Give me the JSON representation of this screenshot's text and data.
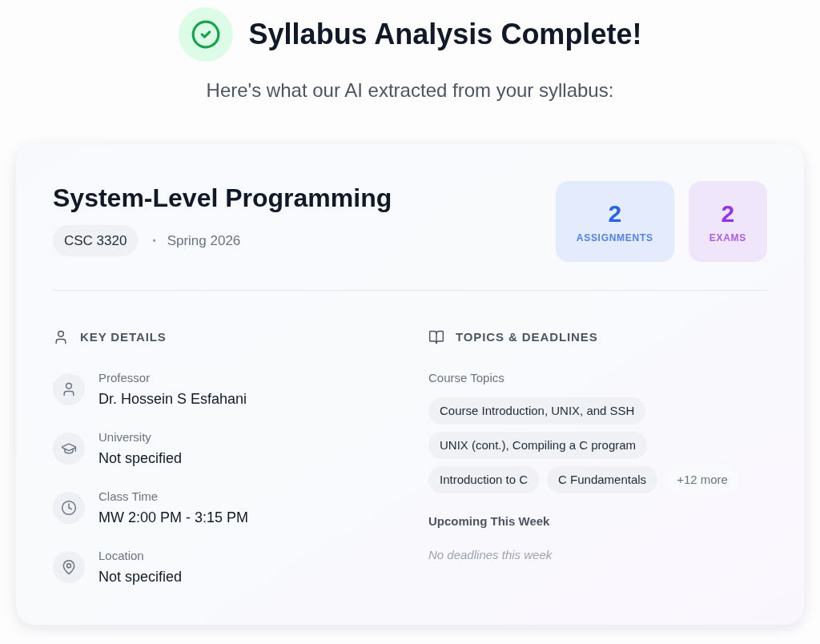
{
  "header": {
    "title": "Syllabus Analysis Complete!",
    "subtitle": "Here's what our AI extracted from your syllabus:"
  },
  "course": {
    "title": "System-Level Programming",
    "code": "CSC 3320",
    "separator": "•",
    "term": "Spring 2026"
  },
  "stats": [
    {
      "value": "2",
      "label": "ASSIGNMENTS",
      "color": "#2563eb"
    },
    {
      "value": "2",
      "label": "EXAMS",
      "color": "#9333ea"
    }
  ],
  "key_details": {
    "heading": "KEY DETAILS",
    "items": [
      {
        "kind": "person",
        "label": "Professor",
        "value": "Dr. Hossein S Esfahani"
      },
      {
        "kind": "school",
        "label": "University",
        "value": "Not specified"
      },
      {
        "kind": "time",
        "label": "Class Time",
        "value": "MW 2:00 PM - 3:15 PM"
      },
      {
        "kind": "place",
        "label": "Location",
        "value": "Not specified"
      }
    ]
  },
  "topics_deadlines": {
    "heading": "TOPICS & DEADLINES",
    "topics_label": "Course Topics",
    "topics": [
      "Course Introduction, UNIX, and SSH",
      "UNIX (cont.), Compiling a C program",
      "Introduction to C",
      "C Fundamentals"
    ],
    "more": "+12 more",
    "upcoming_label": "Upcoming This Week",
    "upcoming_empty": "No deadlines this week"
  }
}
